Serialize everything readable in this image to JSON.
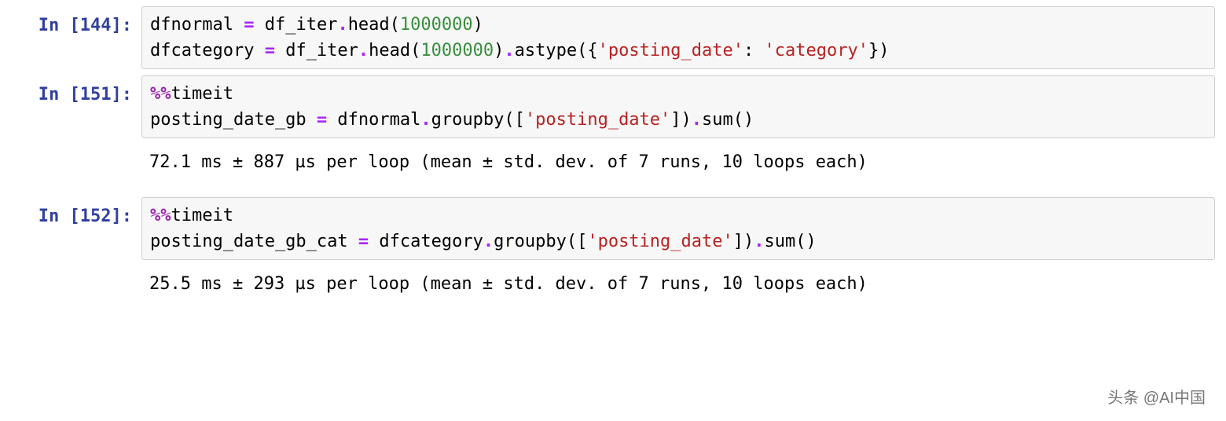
{
  "cells": [
    {
      "prompt": "In [144]:",
      "input_tokens": [
        [
          "plain",
          "dfnormal "
        ],
        [
          "op",
          "="
        ],
        [
          "plain",
          " df_iter"
        ],
        [
          "op",
          "."
        ],
        [
          "plain",
          "head("
        ],
        [
          "num",
          "1000000"
        ],
        [
          "plain",
          ")"
        ],
        [
          "plain",
          "\n"
        ],
        [
          "plain",
          "dfcategory "
        ],
        [
          "op",
          "="
        ],
        [
          "plain",
          " df_iter"
        ],
        [
          "op",
          "."
        ],
        [
          "plain",
          "head("
        ],
        [
          "num",
          "1000000"
        ],
        [
          "plain",
          ")"
        ],
        [
          "op",
          "."
        ],
        [
          "plain",
          "astype({"
        ],
        [
          "str",
          "'posting_date'"
        ],
        [
          "plain",
          ": "
        ],
        [
          "str",
          "'category'"
        ],
        [
          "plain",
          "})"
        ]
      ],
      "output": ""
    },
    {
      "prompt": "In [151]:",
      "input_tokens": [
        [
          "magic",
          "%%"
        ],
        [
          "plain",
          "timeit"
        ],
        [
          "plain",
          "\n"
        ],
        [
          "plain",
          "posting_date_gb "
        ],
        [
          "op",
          "="
        ],
        [
          "plain",
          " dfnormal"
        ],
        [
          "op",
          "."
        ],
        [
          "plain",
          "groupby(["
        ],
        [
          "str",
          "'posting_date'"
        ],
        [
          "plain",
          "])"
        ],
        [
          "op",
          "."
        ],
        [
          "plain",
          "sum()"
        ]
      ],
      "output": "72.1 ms ± 887 µs per loop (mean ± std. dev. of 7 runs, 10 loops each)"
    },
    {
      "prompt": "In [152]:",
      "input_tokens": [
        [
          "magic",
          "%%"
        ],
        [
          "plain",
          "timeit"
        ],
        [
          "plain",
          "\n"
        ],
        [
          "plain",
          "posting_date_gb_cat "
        ],
        [
          "op",
          "="
        ],
        [
          "plain",
          " dfcategory"
        ],
        [
          "op",
          "."
        ],
        [
          "plain",
          "groupby(["
        ],
        [
          "str",
          "'posting_date'"
        ],
        [
          "plain",
          "])"
        ],
        [
          "op",
          "."
        ],
        [
          "plain",
          "sum()"
        ]
      ],
      "output": "25.5 ms ± 293 µs per loop (mean ± std. dev. of 7 runs, 10 loops each)"
    }
  ],
  "watermark": "头条 @AI中国"
}
